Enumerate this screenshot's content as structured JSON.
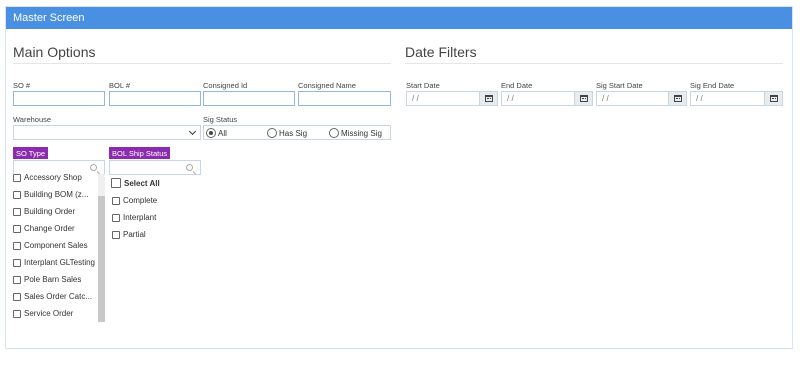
{
  "header": {
    "title": "Master Screen"
  },
  "main_options": {
    "title": "Main Options",
    "fields": [
      {
        "label": "SO #",
        "value": ""
      },
      {
        "label": "BOL #",
        "value": ""
      },
      {
        "label": "Consigned Id",
        "value": ""
      },
      {
        "label": "Consigned Name",
        "value": ""
      }
    ],
    "warehouse": {
      "label": "Warehouse",
      "value": ""
    },
    "sig_status": {
      "label": "Sig Status",
      "options": [
        "All",
        "Has Sig",
        "Missing Sig"
      ],
      "selected": "All"
    },
    "so_type": {
      "label": "SO Type",
      "items": [
        "Accessory Shop",
        "Building BOM (z...",
        "Building Order",
        "Change Order",
        "Component Sales",
        "Interplant GLTesting",
        "Pole Barn Sales",
        "Sales Order Catc...",
        "Service Order"
      ]
    },
    "bol_ship_status": {
      "label": "BOL Ship Status",
      "select_all": "Select All",
      "items": [
        "Complete",
        "Interplant",
        "Partial"
      ]
    }
  },
  "date_filters": {
    "title": "Date Filters",
    "fields": [
      {
        "label": "Start Date",
        "value": "/ /"
      },
      {
        "label": "End Date",
        "value": "/ /"
      },
      {
        "label": "Sig Start Date",
        "value": "/ /"
      },
      {
        "label": "Sig End Date",
        "value": "/ /"
      }
    ]
  },
  "icons": {
    "date_button": "calendar-icon",
    "search": "search-icon",
    "dropdown": "chevron-down-icon"
  }
}
